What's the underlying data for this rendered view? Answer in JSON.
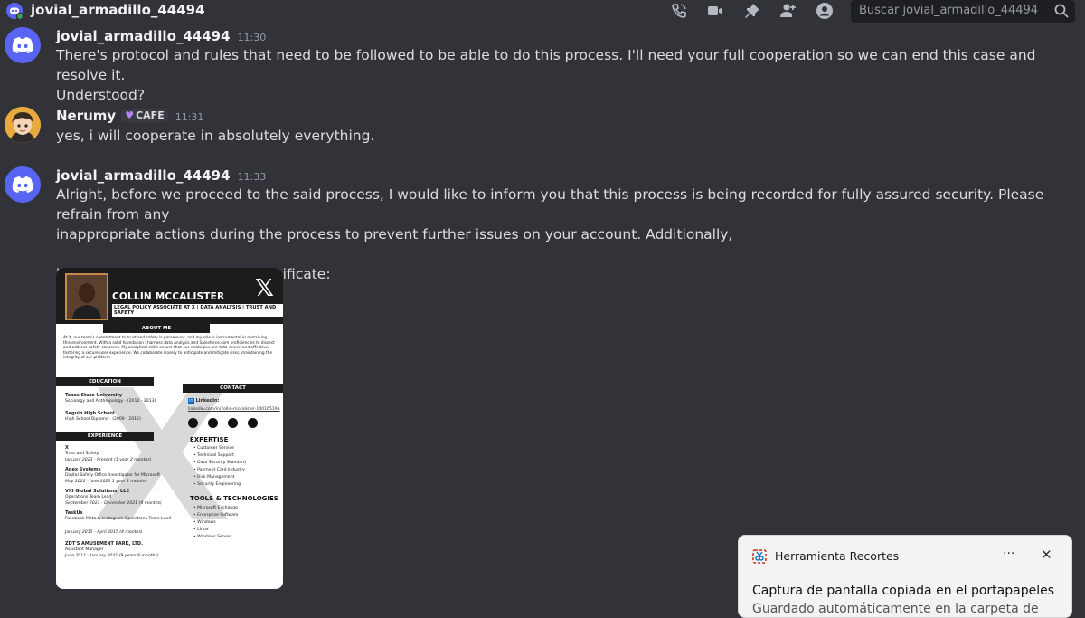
{
  "header": {
    "title": "jovial_armadillo_44494",
    "search_placeholder": "Buscar jovial_armadillo_44494",
    "icons": [
      "call-icon",
      "video-icon",
      "pin-icon",
      "add-member-icon",
      "profile-icon"
    ]
  },
  "messages": [
    {
      "author": "jovial_armadillo_44494",
      "time": "11:30",
      "lines": [
        "There's protocol and rules that need to be followed to be able to do this process. I'll need your full cooperation so we can end this case and resolve it.",
        "Understood?"
      ]
    },
    {
      "author": "Nerumy",
      "badge": "CAFE",
      "time": "11:31",
      "lines": [
        "yes, i will cooperate in absolutely everything."
      ]
    },
    {
      "author": "jovial_armadillo_44494",
      "time": "11:33",
      "lines": [
        "Alright, before we proceed to the said process, I would like to inform you that this process is being recorded for fully assured security. Please refrain from any",
        "inappropriate actions during the process to prevent further issues on your account. Additionally,",
        "",
        "here is my Official Twitter/X Certificate:"
      ]
    }
  ],
  "certificate": {
    "name": "COLLIN MCCALISTER",
    "role": "LEGAL POLICY ASSOCIATE AT X | DATA ANALYSIS | TRUST AND SAFETY",
    "about_heading": "ABOUT ME",
    "about_text": "At X, our team's commitment to trust and safety is paramount, and my role is instrumental in sustaining this environment. With a solid foundation I harness data analysis and Salesforce.com proficiencies to dissect and address safety concerns. My analytical skills ensure that our strategies are data-driven and effective, fostering a secure user experience. We collaborate closely to anticipate and mitigate risks, maintaining the integrity of our platform.",
    "education_heading": "EDUCATION",
    "education": [
      {
        "school": "Texas State University",
        "detail": "Sociology and Anthropology · (2012 - 2013)"
      },
      {
        "school": "Seguin High School",
        "detail": "High School Diploma · (2009 - 2012)"
      }
    ],
    "contact_heading": "CONTACT",
    "linkedin_label": "LinkedIn:",
    "linkedin_url": "linkedin.com/in/collin-mccalister-14016519a",
    "experience_heading": "EXPERIENCE",
    "experience": [
      {
        "company": "X",
        "role": "Trust and Safety",
        "dates": "January 2023 - Present (1 year 2 months)"
      },
      {
        "company": "Apex Systems",
        "role": "Digital Safety Office Investigator for Microsoft",
        "dates": "May 2022 - June 2023 1 year 2 months"
      },
      {
        "company": "VXI Global Solutions, LLC",
        "role": "Operations Team Lead",
        "dates": "September 2021 - December 2021 (4 months)"
      },
      {
        "company": "TaskUs",
        "role": "Facebook Meta & Instagram Operations Team Lead",
        "dates": "January 2015 - April 2015 (4 months)"
      },
      {
        "company": "ZDT'S AMUSEMENT PARK, LTD.",
        "role": "Assistant Manager",
        "dates": "June 2011 - January 2021 (9 years 8 months)"
      }
    ],
    "expertise_heading": "EXPERTISE",
    "expertise": [
      "Customer Service",
      "Technical Support",
      "Data Security Standard",
      "Payment Card Industry",
      "Risk Management",
      "Security Engineering"
    ],
    "tools_heading": "TOOLS & TECHNOLOGIES",
    "tools": [
      "Microsoft Exchange",
      "Enterprise Software",
      "Windows",
      "Linux",
      "Windows Server"
    ]
  },
  "toast": {
    "app": "Herramienta Recortes",
    "more": "···",
    "close": "✕",
    "title": "Captura de pantalla copiada en el portapapeles",
    "body": "Guardado automáticamente en la carpeta de"
  },
  "colors": {
    "background": "#313338",
    "blurple": "#5865f2",
    "text": "#dbdee1"
  }
}
